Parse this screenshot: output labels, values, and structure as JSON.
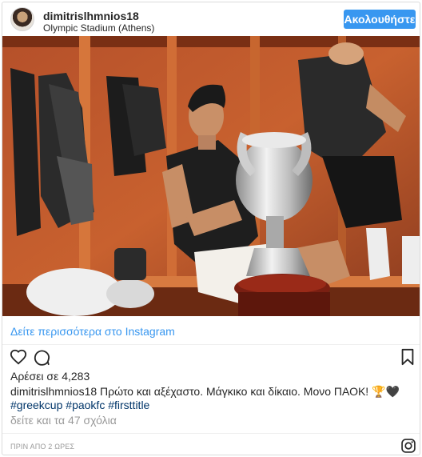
{
  "post": {
    "username": "dimitrislhmnios18",
    "location": "Olympic Stadium (Athens)",
    "follow_label": "Ακολουθήστε",
    "see_more_label": "Δείτε περισσότερα στο Instagram",
    "likes_text": "Αρέσει σε 4,283",
    "caption_user": "dimitrislhmnios18",
    "caption_text": " Πρώτο και αξέχαστο. Μάγκικο και δίκαιο. Μονο ΠΑΟΚ! 🏆🖤",
    "caption_tag_1": "#greekcup",
    "caption_tag_2": "#paokfc",
    "caption_tag_3": "#firsttitle",
    "comments_text": "δείτε και τα 47 σχόλια",
    "time_text": "ΠΡΙΝ ΑΠΟ 2 ΩΡΕΣ"
  },
  "icons": {
    "like": "heart-icon",
    "comment": "comment-icon",
    "save": "bookmark-icon",
    "brand": "instagram-icon"
  },
  "colors": {
    "accent": "#3897f0",
    "hashtag": "#003569",
    "muted": "#999999",
    "text": "#262626"
  }
}
